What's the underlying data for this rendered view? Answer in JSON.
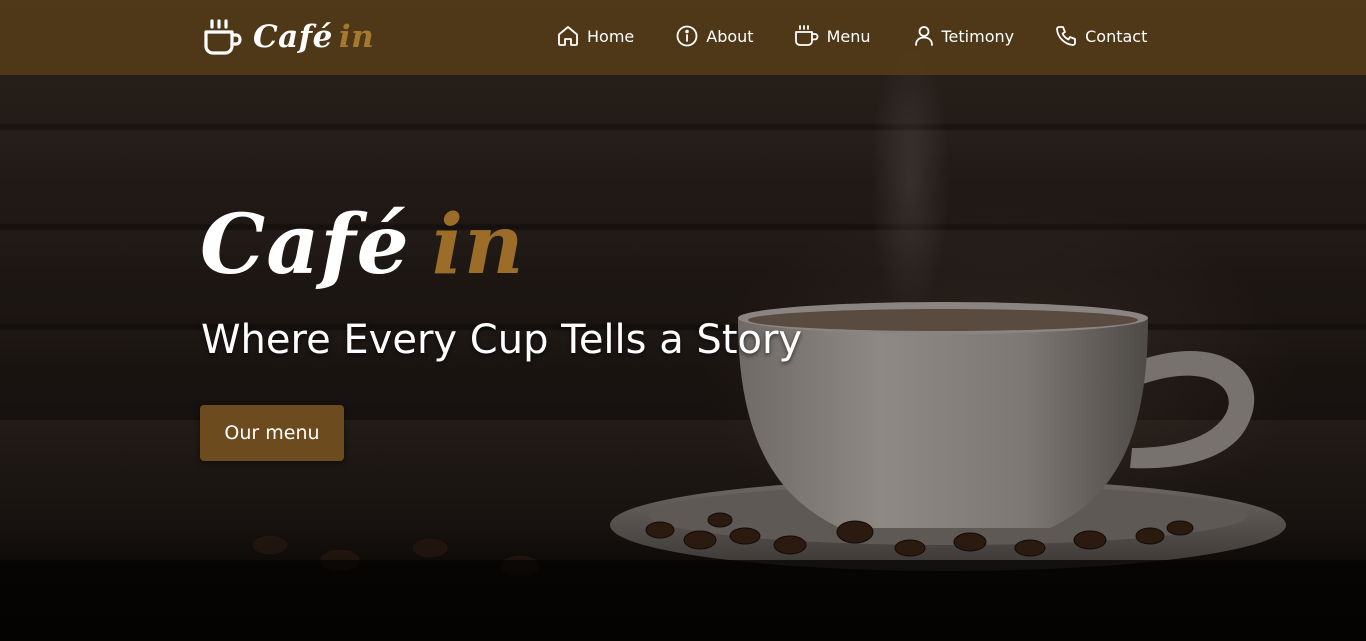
{
  "brand": {
    "name": "Café",
    "accent": "in",
    "icon": "coffee-cup-icon"
  },
  "nav": {
    "items": [
      {
        "label": "Home",
        "icon": "home-icon"
      },
      {
        "label": "About",
        "icon": "info-icon"
      },
      {
        "label": "Menu",
        "icon": "coffee-cup-icon"
      },
      {
        "label": "Tetimony",
        "icon": "user-icon"
      },
      {
        "label": "Contact",
        "icon": "phone-icon"
      }
    ]
  },
  "hero": {
    "title": "Café",
    "title_accent": "in",
    "subtitle": "Where Every Cup Tells a Story",
    "cta_label": "Our menu"
  },
  "colors": {
    "navbar_bg": "#583e18",
    "accent": "#a5782f",
    "button_bg": "#6c4c1f",
    "text": "#ffffff"
  }
}
